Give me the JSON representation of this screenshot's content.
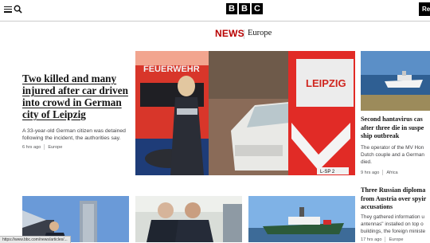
{
  "header": {
    "logo_letters": [
      "B",
      "B",
      "C"
    ],
    "register_label": "Re",
    "menu_icon": "hamburger-icon",
    "search_icon": "search-icon"
  },
  "section_nav": {
    "news_label": "NEWS",
    "section_label": "Europe",
    "accent_color": "#b80000"
  },
  "lead_story": {
    "headline": "Two killed and many injured after car driven into crowd in German city of Leipzig",
    "summary": "A 33-year-old German citizen was detained following the incident, the authorities say.",
    "time": "6 hrs ago",
    "tag": "Europe",
    "image_text": {
      "truck_left": "FEUERWEHR",
      "truck_right": "LEIPZIG",
      "plate": "L-SP 2"
    }
  },
  "side_stories": [
    {
      "title_lines": [
        "Second hantavirus cas",
        "after three die in suspe",
        "ship outbreak"
      ],
      "desc_lines": [
        "The operator of the MV Hon",
        "Dutch couple and a German",
        "died."
      ],
      "time": "9 hrs ago",
      "tag": "Africa"
    },
    {
      "title_lines": [
        "Three Russian diploma",
        "from Austria over spyir",
        "accusations"
      ],
      "desc_lines": [
        "They gathered information u",
        "antennas\" installed on top o",
        "buildings, the foreign ministe"
      ],
      "time": "17 hrs ago",
      "tag": "Europe"
    }
  ],
  "status_url": "https://www.bbc.com/news/articles/..."
}
